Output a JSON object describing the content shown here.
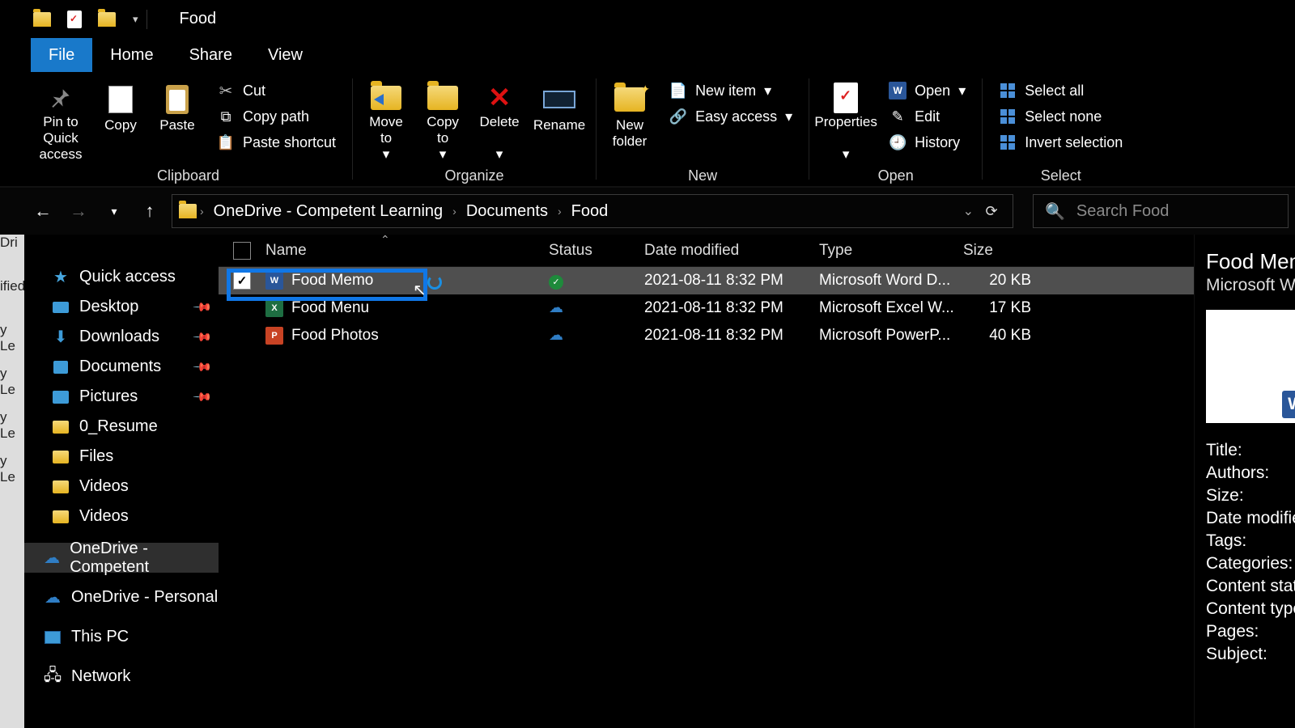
{
  "title": "Food",
  "tabs": {
    "file": "File",
    "home": "Home",
    "share": "Share",
    "view": "View"
  },
  "ribbon": {
    "clipboard": {
      "label": "Clipboard",
      "pin": "Pin to Quick\naccess",
      "copy": "Copy",
      "paste": "Paste",
      "cut": "Cut",
      "copypath": "Copy path",
      "pasteshortcut": "Paste shortcut"
    },
    "organize": {
      "label": "Organize",
      "moveto": "Move\nto",
      "copyto": "Copy\nto",
      "delete": "Delete",
      "rename": "Rename"
    },
    "new": {
      "label": "New",
      "newfolder": "New\nfolder",
      "newitem": "New item",
      "easyaccess": "Easy access"
    },
    "open": {
      "label": "Open",
      "properties": "Properties",
      "open": "Open",
      "edit": "Edit",
      "history": "History"
    },
    "select": {
      "label": "Select",
      "selectall": "Select all",
      "selectnone": "Select none",
      "invert": "Invert selection"
    }
  },
  "breadcrumbs": [
    "OneDrive - Competent Learning",
    "Documents",
    "Food"
  ],
  "search_placeholder": "Search Food",
  "tree": {
    "quickaccess": "Quick access",
    "desktop": "Desktop",
    "downloads": "Downloads",
    "documents": "Documents",
    "pictures": "Pictures",
    "resume": "0_Resume",
    "files": "Files",
    "videos1": "Videos",
    "videos2": "Videos",
    "onedrive_comp": "OneDrive - Competent",
    "onedrive_pers": "OneDrive - Personal",
    "thispc": "This PC",
    "network": "Network"
  },
  "columns": {
    "name": "Name",
    "status": "Status",
    "date": "Date modified",
    "type": "Type",
    "size": "Size"
  },
  "files": [
    {
      "name": "Food Memo",
      "icon": "word",
      "status": "synced",
      "date": "2021-08-11 8:32 PM",
      "type": "Microsoft Word D...",
      "size": "20 KB",
      "selected": true
    },
    {
      "name": "Food Menu",
      "icon": "excel",
      "status": "cloud",
      "date": "2021-08-11 8:32 PM",
      "type": "Microsoft Excel W...",
      "size": "17 KB",
      "selected": false
    },
    {
      "name": "Food Photos",
      "icon": "ppt",
      "status": "cloud",
      "date": "2021-08-11 8:32 PM",
      "type": "Microsoft PowerP...",
      "size": "40 KB",
      "selected": false
    }
  ],
  "details": {
    "title": "Food Memo",
    "subtitle": "Microsoft Word",
    "fields": [
      "Title:",
      "Authors:",
      "Size:",
      "Date modified:",
      "Tags:",
      "Categories:",
      "Content status:",
      "Content type:",
      "Pages:",
      "Subject:"
    ]
  },
  "left_sliver": [
    "Dri",
    "ified",
    "y Le",
    "y Le",
    "y Le",
    "y Le"
  ]
}
